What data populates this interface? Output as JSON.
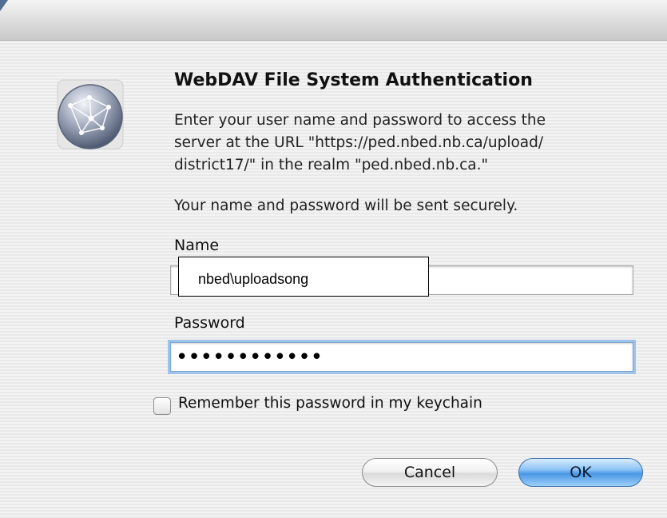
{
  "dialog": {
    "title": "WebDAV File System Authentication",
    "message": "Enter your user name and password to access the\nserver at the URL \"https://ped.nbed.nb.ca/upload/\ndistrict17/\" in the realm \"ped.nbed.nb.ca.\"",
    "secure_note": "Your name and password will be sent securely.",
    "icon": "network-globe-icon"
  },
  "form": {
    "name_label": "Name",
    "name_value": "nbed\\uploadsong",
    "password_label": "Password",
    "password_masked": "••••••••••••",
    "remember_label": "Remember this password in my keychain",
    "remember_checked": false
  },
  "buttons": {
    "cancel_label": "Cancel",
    "ok_label": "OK"
  },
  "colors": {
    "default_button": "#4a97e4",
    "focus_ring": "#9fc2e8"
  }
}
